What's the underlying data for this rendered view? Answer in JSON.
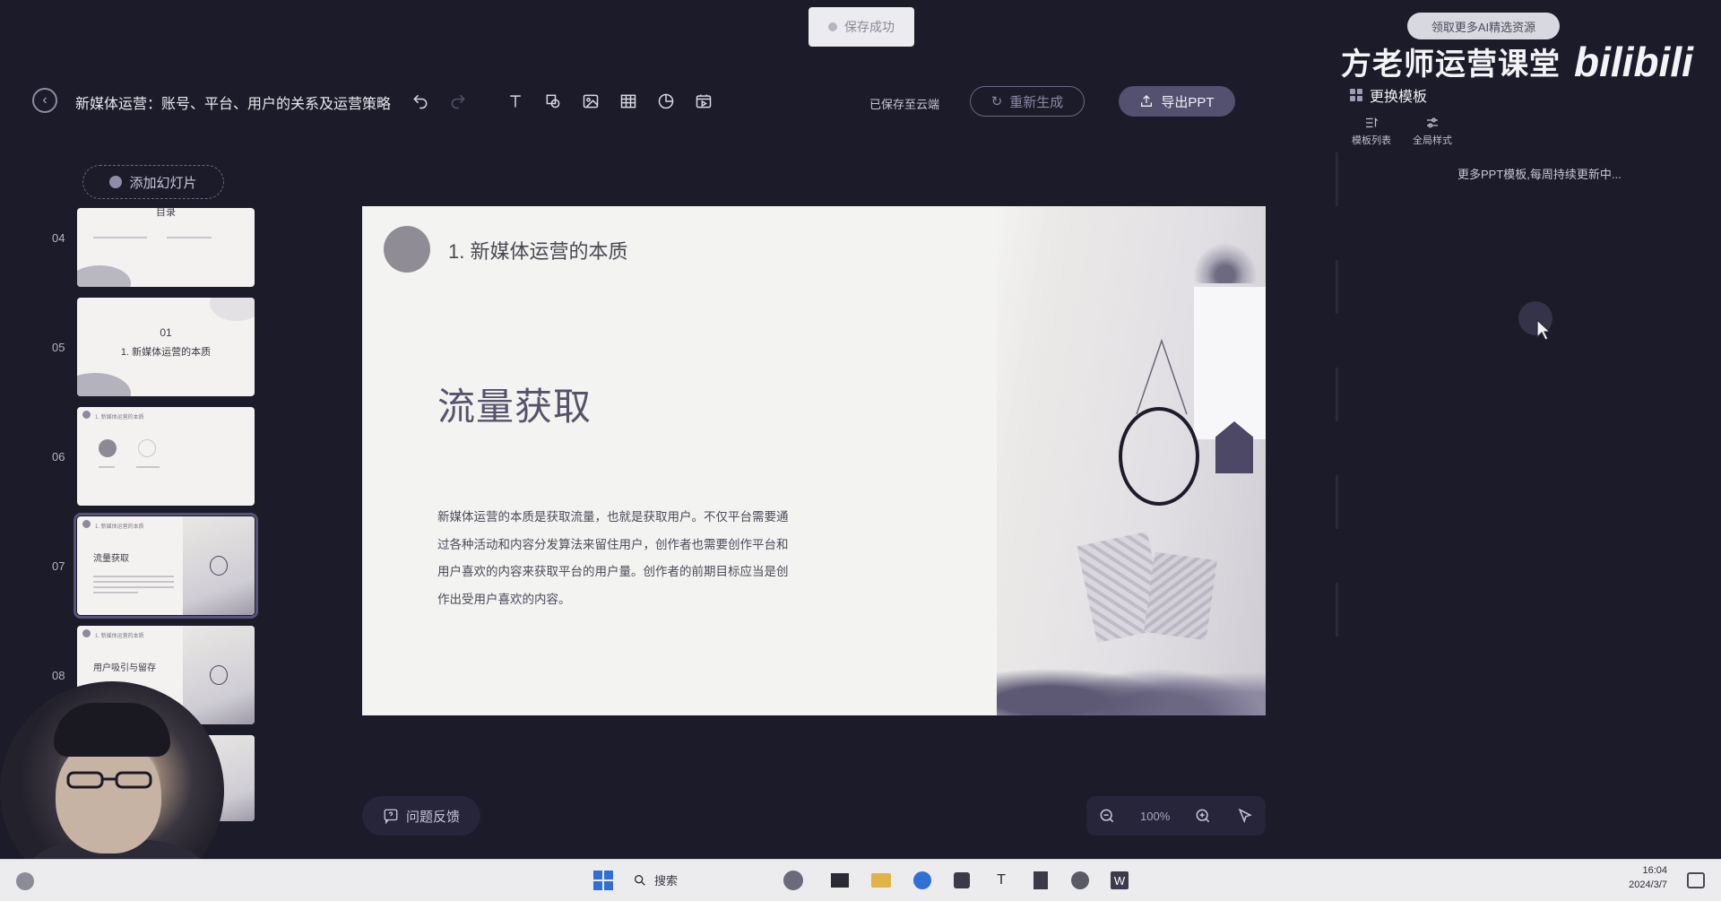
{
  "toast": {
    "text": "保存成功"
  },
  "header": {
    "doc_title": "新媒体运营：账号、平台、用户的关系及运营策略",
    "cloud_status": "已保存至云端",
    "regen_label": "重新生成",
    "export_label": "导出PPT"
  },
  "watermark": {
    "channel_name": "方老师运营课堂",
    "site": "bilibili",
    "banner": "领取更多AI精选资源"
  },
  "right_panel": {
    "change_template_label": "更换模板",
    "tabs": [
      {
        "label": "模板列表",
        "icon": "list-icon"
      },
      {
        "label": "全局样式",
        "icon": "sliders-icon"
      }
    ],
    "more_text": "更多PPT模板,每周持续更新中..."
  },
  "slide_list": {
    "add_label": "添加幻灯片",
    "slides": [
      {
        "number": "04",
        "title": "目录"
      },
      {
        "number": "05",
        "index": "01",
        "title": "1. 新媒体运营的本质"
      },
      {
        "number": "06",
        "title": "1. 新媒体运营的本质"
      },
      {
        "number": "07",
        "title": "流量获取",
        "active": true
      },
      {
        "number": "08",
        "title": "用户吸引与留存"
      }
    ]
  },
  "slide": {
    "header": "1. 新媒体运营的本质",
    "title": "流量获取",
    "body": "新媒体运营的本质是获取流量，也就是获取用户。不仅平台需要通过各种活动和内容分发算法来留住用户，创作者也需要创作平台和用户喜欢的内容来获取平台的用户量。创作者的前期目标应当是创作出受用户喜欢的内容。"
  },
  "bottom": {
    "feedback_label": "问题反馈",
    "zoom_level": "100%"
  },
  "taskbar": {
    "search_label": "搜索",
    "time": "16:04",
    "date": "2024/3/7"
  },
  "colors": {
    "background": "#1c1b29",
    "accent": "#545070",
    "slide_bg": "#f3f3f1"
  }
}
